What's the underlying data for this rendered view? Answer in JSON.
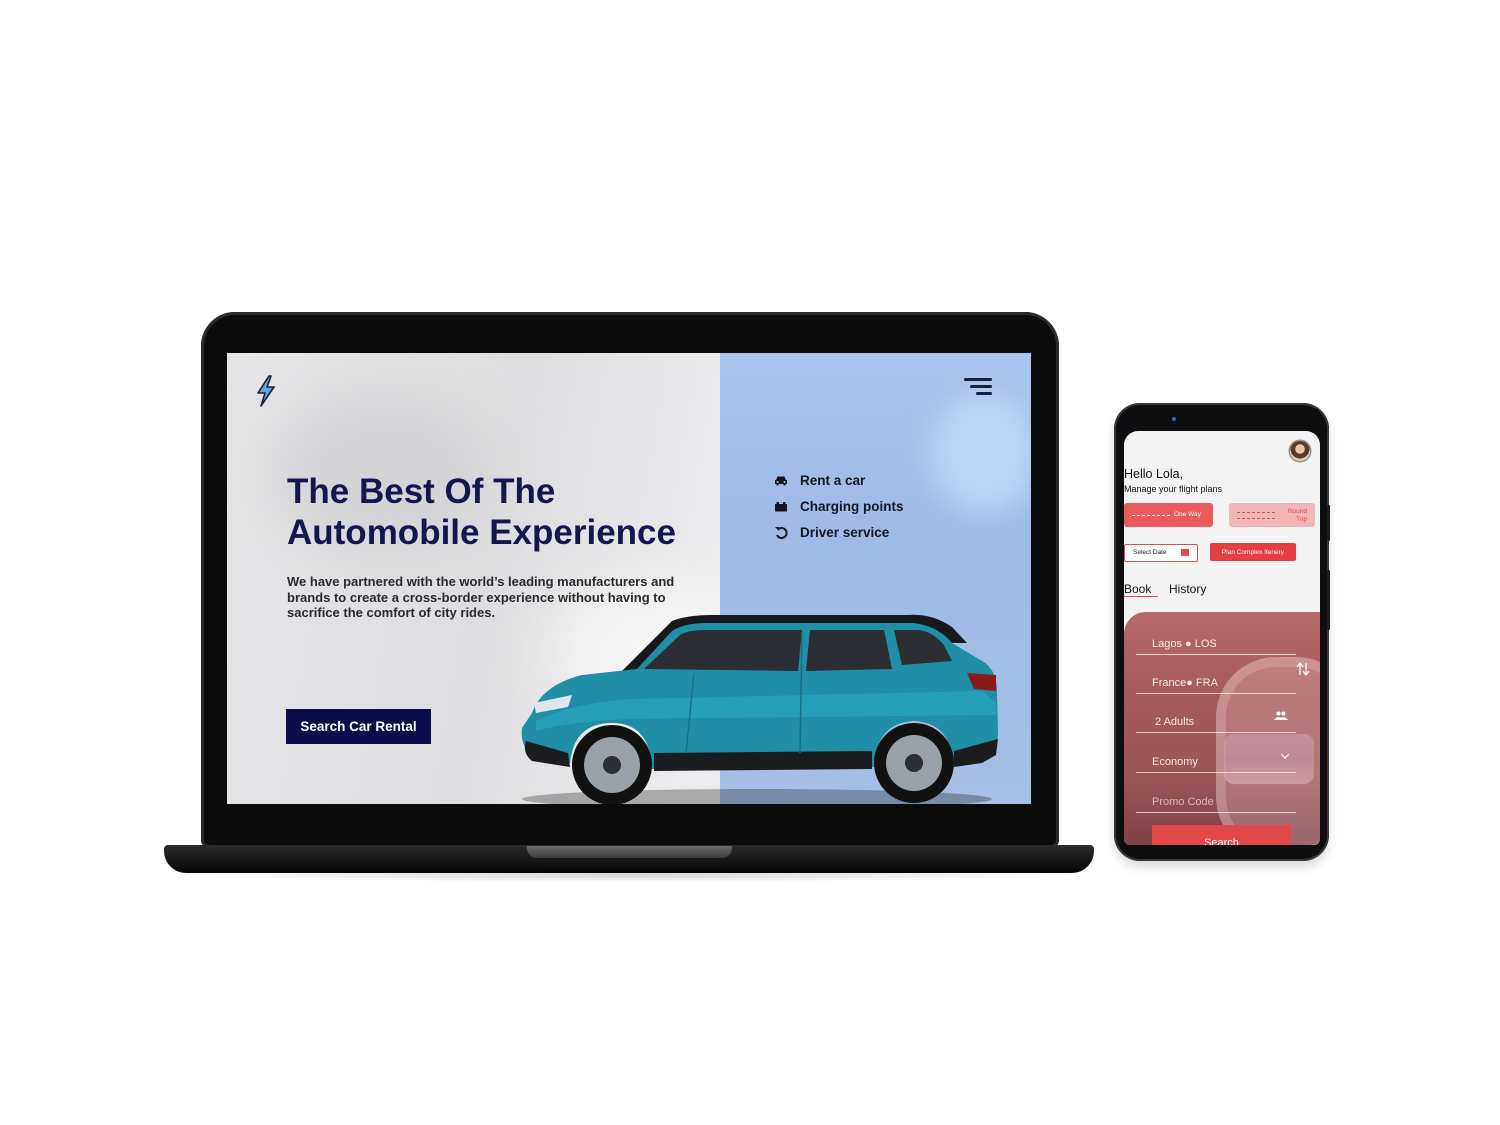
{
  "laptop": {
    "hero": {
      "headline": "The Best  Of The\nAutomobile Experience",
      "paragraph": "We have partnered with the world’s leading manufacturers and brands to create a cross-border experience without having to sacrifice the comfort of city rides.",
      "cta_label": "Search Car Rental"
    },
    "menu": {
      "items": [
        {
          "label": "Rent a car",
          "icon": "car-icon"
        },
        {
          "label": "Charging points",
          "icon": "battery-icon"
        },
        {
          "label": "Driver service",
          "icon": "refresh-icon"
        }
      ]
    },
    "colors": {
      "primary": "#14164f",
      "cta": "#0d0d4d",
      "panel": "#a8c4ec"
    }
  },
  "phone": {
    "greeting": "Hello Lola,",
    "subtitle": "Manage your flight plans",
    "trip_types": [
      "One Way",
      "Round\nTrip"
    ],
    "select_date": "Select Date",
    "plan_label": "Plan Complex Itenery",
    "tabs": [
      "Book",
      "History"
    ],
    "fields": {
      "from": "Lagos ● LOS",
      "to": "France● FRA",
      "passengers": "2 Adults",
      "cabin": "Economy",
      "promo_placeholder": "Promo Code"
    },
    "search_label": "Search",
    "colors": {
      "accent": "#e53e41"
    }
  }
}
